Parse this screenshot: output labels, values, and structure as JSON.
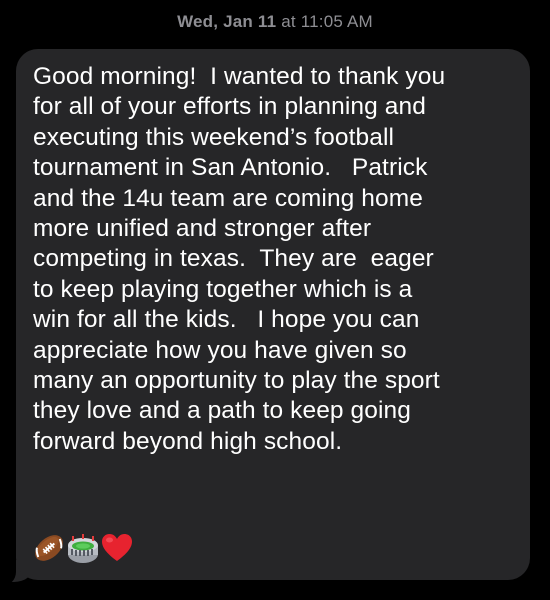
{
  "header": {
    "day": "Wed, Jan 11",
    "time": "at 11:05 AM"
  },
  "message": {
    "lines": [
      "Good morning!  I wanted to thank you",
      "for all of your efforts in planning and",
      "executing this weekend’s football",
      "tournament in San Antonio.   Patrick",
      "and the 14u team are coming home",
      "more unified and stronger after",
      "competing in texas.  They are  eager",
      "to keep playing together which is a",
      "win for all the kids.   I hope you can",
      "appreciate how you have given so",
      "many an opportunity to play the sport",
      "they love and a path to keep going",
      "forward beyond high school."
    ],
    "emojis": [
      "football-icon",
      "stadium-icon",
      "red-heart-icon"
    ]
  },
  "colors": {
    "background": "#000000",
    "bubble": "#262628",
    "text": "#ffffff",
    "timestamp": "#8e8e93"
  }
}
